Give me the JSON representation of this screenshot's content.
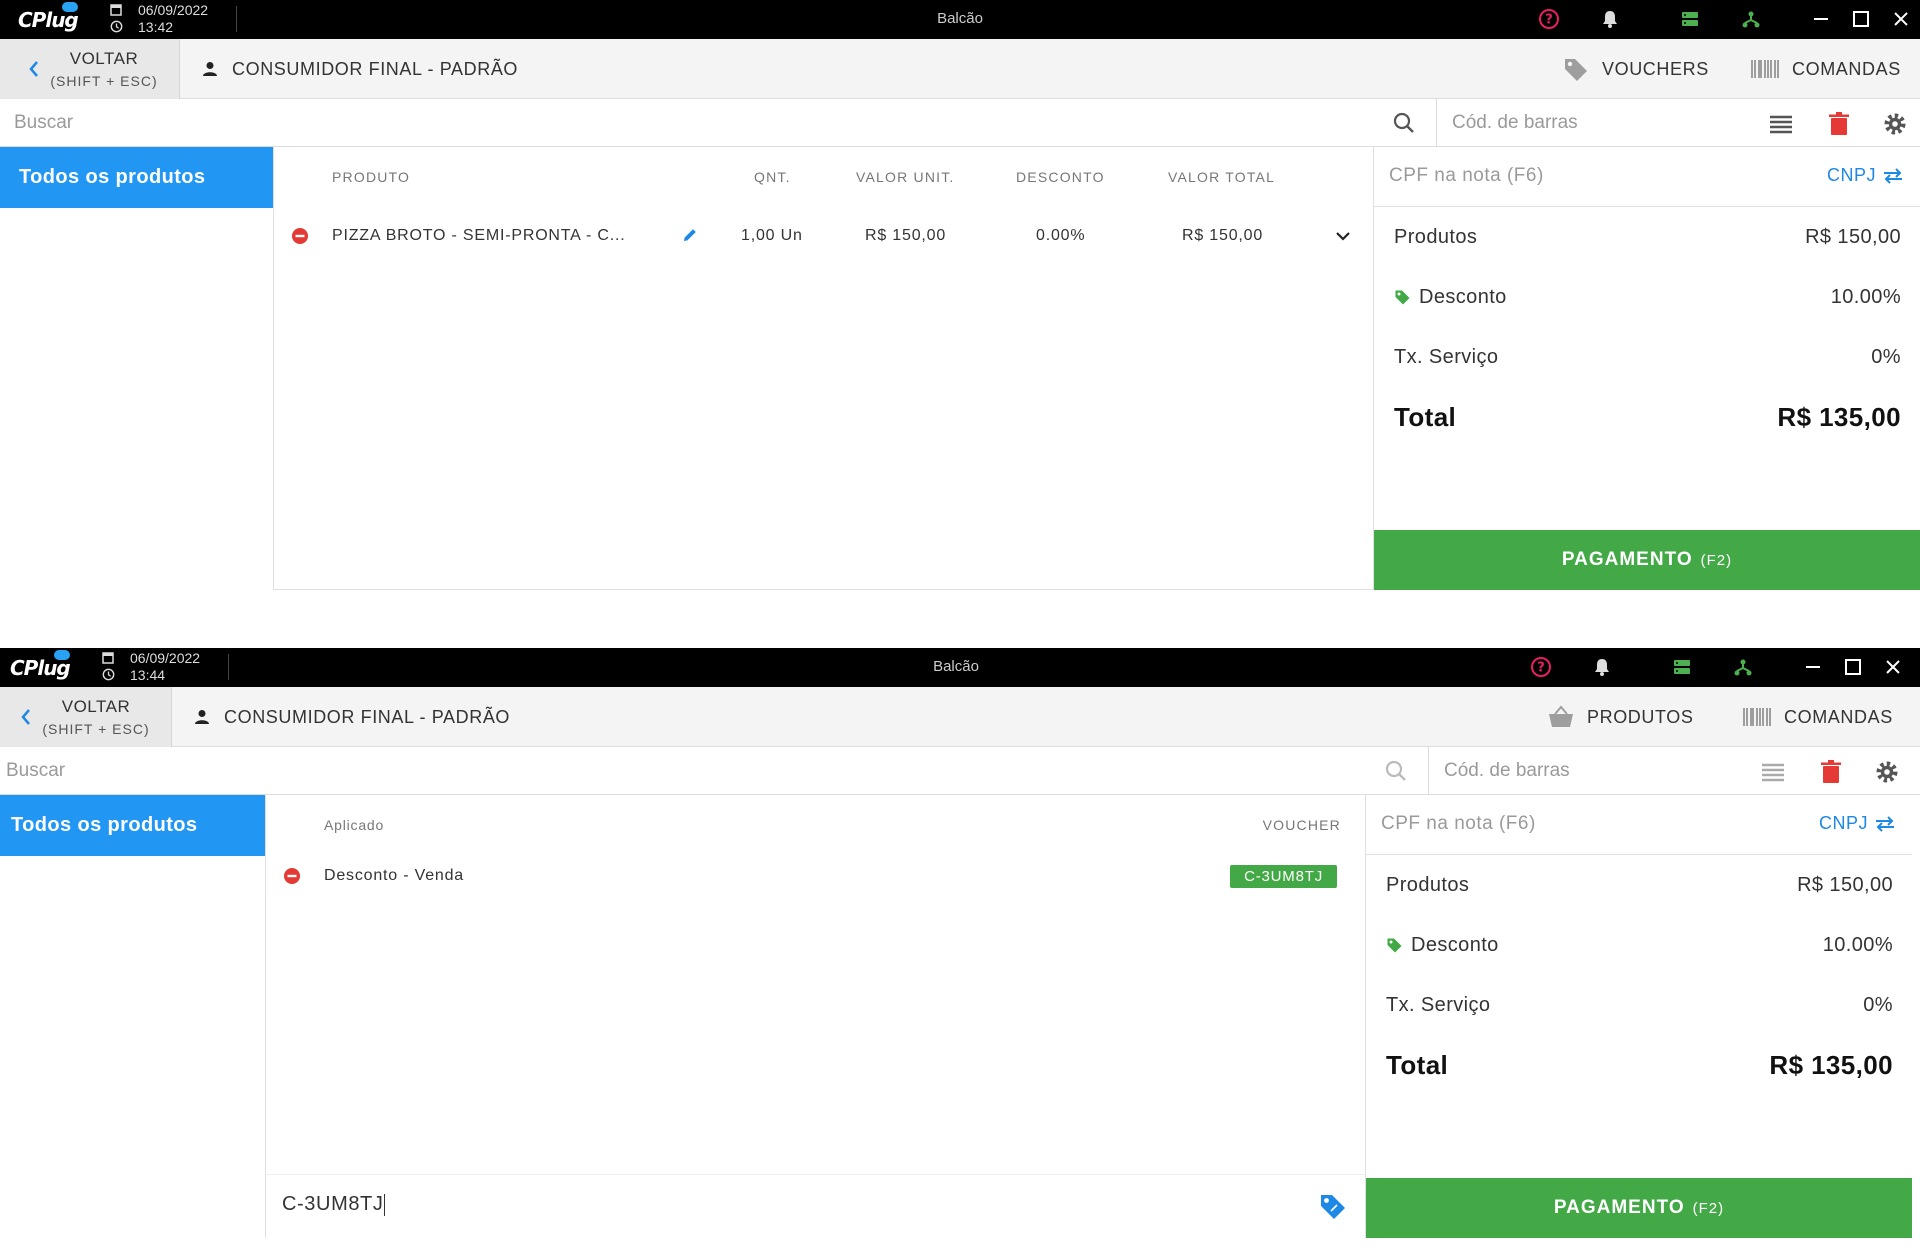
{
  "app": {
    "logo": "CPlug",
    "window_title": "Balcão"
  },
  "colors": {
    "accent": "#2196f3",
    "pay": "#43a947",
    "danger": "#e53935",
    "link": "#1e88e5"
  },
  "screen1": {
    "date": "06/09/2022",
    "time": "13:42",
    "header": {
      "back_label": "VOLTAR",
      "back_shortcut": "(SHIFT + ESC)",
      "customer": "CONSUMIDOR FINAL - PADRÃO",
      "buttons": [
        "VOUCHERS",
        "COMANDAS"
      ]
    },
    "search": {
      "placeholder": "Buscar",
      "barcode_placeholder": "Cód. de barras"
    },
    "category": "Todos os produtos",
    "table": {
      "headers": [
        "PRODUTO",
        "QNT.",
        "VALOR UNIT.",
        "DESCONTO",
        "VALOR TOTAL"
      ],
      "rows": [
        {
          "produto": "PIZZA BROTO - SEMI-PRONTA - C...",
          "qnt": "1,00 Un",
          "valor_unit": "R$ 150,00",
          "desconto": "0.00%",
          "valor_total": "R$ 150,00"
        }
      ]
    },
    "summary": {
      "cpf_placeholder": "CPF na nota (F6)",
      "cnpj": "CNPJ",
      "produtos_label": "Produtos",
      "produtos_value": "R$ 150,00",
      "desconto_label": "Desconto",
      "desconto_value": "10.00%",
      "servico_label": "Tx. Serviço",
      "servico_value": "0%",
      "total_label": "Total",
      "total_value": "R$ 135,00",
      "pay_label": "PAGAMENTO",
      "pay_key": "(F2)"
    }
  },
  "screen2": {
    "date": "06/09/2022",
    "time": "13:44",
    "header": {
      "back_label": "VOLTAR",
      "back_shortcut": "(SHIFT + ESC)",
      "customer": "CONSUMIDOR FINAL - PADRÃO",
      "buttons": [
        "PRODUTOS",
        "COMANDAS"
      ]
    },
    "search": {
      "placeholder": "Buscar",
      "barcode_placeholder": "Cód. de barras"
    },
    "category": "Todos os produtos",
    "vouchers": {
      "headers": [
        "Aplicado",
        "VOUCHER"
      ],
      "rows": [
        {
          "aplicado": "Desconto - Venda",
          "voucher": "C-3UM8TJ"
        }
      ],
      "input_value": "C-3UM8TJ"
    },
    "summary": {
      "cpf_placeholder": "CPF na nota (F6)",
      "cnpj": "CNPJ",
      "produtos_label": "Produtos",
      "produtos_value": "R$ 150,00",
      "desconto_label": "Desconto",
      "desconto_value": "10.00%",
      "servico_label": "Tx. Serviço",
      "servico_value": "0%",
      "total_label": "Total",
      "total_value": "R$ 135,00",
      "pay_label": "PAGAMENTO",
      "pay_key": "(F2)"
    }
  }
}
